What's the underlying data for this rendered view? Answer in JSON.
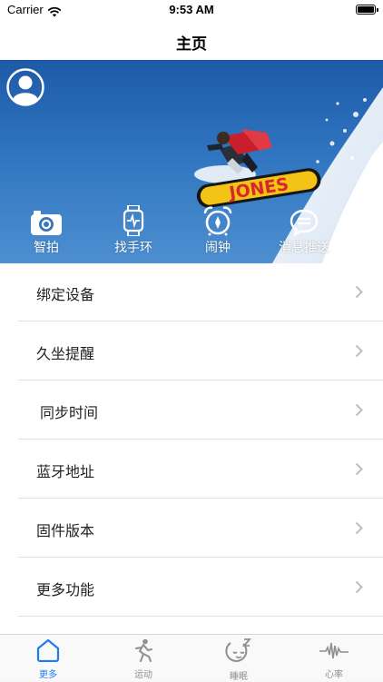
{
  "status_bar": {
    "carrier": "Carrier",
    "time": "9:53 AM"
  },
  "nav": {
    "title": "主页"
  },
  "hero": {
    "board_text": "JONES",
    "actions": [
      {
        "label": "智拍",
        "icon": "camera-icon"
      },
      {
        "label": "找手环",
        "icon": "smartwatch-icon"
      },
      {
        "label": "闹钟",
        "icon": "alarm-clock-icon"
      },
      {
        "label": "消息推送",
        "icon": "message-icon"
      }
    ]
  },
  "menu": [
    {
      "label": "绑定设备"
    },
    {
      "label": "久坐提醒"
    },
    {
      "label": "同步时间"
    },
    {
      "label": "蓝牙地址"
    },
    {
      "label": "固件版本"
    },
    {
      "label": "更多功能"
    }
  ],
  "tabs": [
    {
      "label": "更多",
      "icon": "home-icon",
      "active": true
    },
    {
      "label": "运动",
      "icon": "running-icon",
      "active": false
    },
    {
      "label": "睡眠",
      "icon": "sleep-icon",
      "active": false
    },
    {
      "label": "心率",
      "icon": "heart-rate-icon",
      "active": false
    }
  ],
  "colors": {
    "accent": "#1e7cf2",
    "tab_inactive": "#8e8e93",
    "hero_blue": "#2f74bf"
  }
}
